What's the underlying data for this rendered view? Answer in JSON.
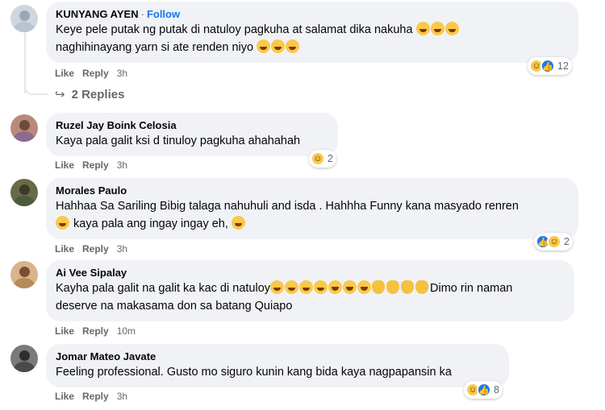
{
  "comments": [
    {
      "author": "KUNYANG AYEN",
      "follow": "Follow",
      "lines": [
        "Keye pele putak ng putak di natuloy pagkuha at salamat dika nakuha",
        "naghihinayang yarn si ate renden niyo"
      ],
      "like": "Like",
      "reply": "Reply",
      "time": "3h",
      "reaction_count": "12",
      "reactions": [
        "haha-icon",
        "like-icon"
      ]
    },
    {
      "author": "Ruzel Jay Boink Celosia",
      "lines": [
        "Kaya pala galit ksi d tinuloy pagkuha ahahahah"
      ],
      "like": "Like",
      "reply": "Reply",
      "time": "3h",
      "reaction_count": "2",
      "reactions": [
        "haha-icon"
      ]
    },
    {
      "author": "Morales Paulo",
      "lines": [
        "Hahhaa Sa Sariling Bibig talaga nahuhuli and isda . Hahhha Funny kana masyado renren",
        "kaya pala ang ingay ingay eh,"
      ],
      "like": "Like",
      "reply": "Reply",
      "time": "3h",
      "reaction_count": "2",
      "reactions": [
        "like-icon",
        "haha-icon"
      ]
    },
    {
      "author": "Ai Vee Sipalay",
      "lines": [
        "Kayha pala galit na galit ka kac di natuloy",
        "Dimo rin naman",
        "deserve na makasama don sa batang Quiapo"
      ],
      "like": "Like",
      "reply": "Reply",
      "time": "10m"
    },
    {
      "author": "Jomar Mateo Javate",
      "lines": [
        "Feeling professional. Gusto mo siguro kunin kang bida kaya nagpapansin ka"
      ],
      "like": "Like",
      "reply": "Reply",
      "time": "3h",
      "reaction_count": "8",
      "reactions": [
        "haha-icon",
        "like-icon"
      ]
    }
  ],
  "replies_label": "2 Replies",
  "colors": {
    "bubble": "#f0f2f5",
    "follow": "#1876f2",
    "meta": "#65676b",
    "like": "#1877f2",
    "haha": "#fcc84a"
  }
}
